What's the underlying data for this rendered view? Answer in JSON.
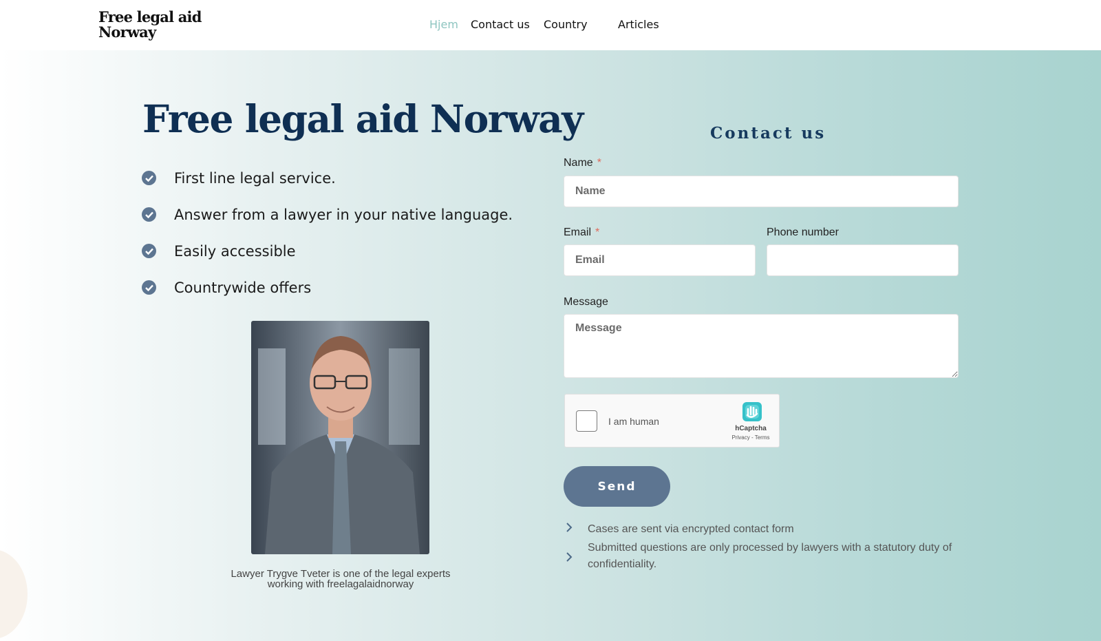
{
  "header": {
    "logo_line1": "Free legal aid",
    "logo_line2": "Norway",
    "nav": [
      {
        "label": "Hjem",
        "active": true
      },
      {
        "label": "Contact us"
      },
      {
        "label": "Country"
      },
      {
        "label": "Articles"
      }
    ]
  },
  "hero": {
    "title": "Free legal aid Norway",
    "features": [
      {
        "icon": "check-circle-icon",
        "text": "First line legal service."
      },
      {
        "icon": "check-circle-icon",
        "text": "Answer from a lawyer in your native language."
      },
      {
        "icon": "check-circle-icon",
        "text": "Easily accessible"
      },
      {
        "icon": "check-circle-icon",
        "text": "Countrywide offers"
      }
    ],
    "photo_caption_line1": "Lawyer Trygve Tveter is one of the legal experts",
    "photo_caption_line2": "working with freelagalaidnorway"
  },
  "contact": {
    "title": "Contact us",
    "name_label": "Name",
    "name_placeholder": "Name",
    "email_label": "Email",
    "email_placeholder": "Email",
    "phone_label": "Phone number",
    "phone_placeholder": "",
    "message_label": "Message",
    "message_placeholder": "Message",
    "required_mark": "*",
    "captcha": {
      "label": "I am human",
      "brand": "hCaptcha",
      "links": "Privacy - Terms"
    },
    "send_label": "Send",
    "notes": [
      "Cases are sent via encrypted contact form",
      "Submitted questions are only processed by lawyers with a statutory duty of confidentiality."
    ]
  },
  "colors": {
    "accent": "#5d7591",
    "title": "#0f2f53",
    "nav_active": "#8ec5c0"
  }
}
